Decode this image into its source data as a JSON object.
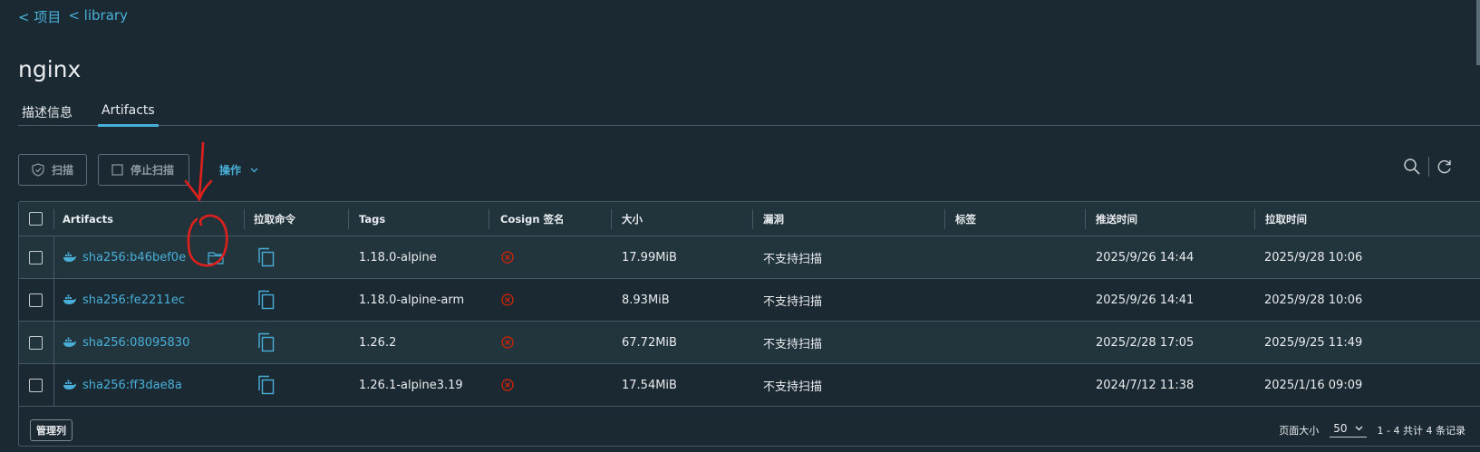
{
  "breadcrumb": [
    {
      "label": "< 项目"
    },
    {
      "label": "< library"
    }
  ],
  "page_title": "nginx",
  "tabs": [
    {
      "label": "描述信息",
      "active": false
    },
    {
      "label": "Artifacts",
      "active": true
    }
  ],
  "toolbar": {
    "scan_label": "扫描",
    "stop_scan_label": "停止扫描",
    "actions_label": "操作"
  },
  "table": {
    "headers": [
      "Artifacts",
      "拉取命令",
      "Tags",
      "Cosign 签名",
      "大小",
      "漏洞",
      "标签",
      "推送时间",
      "拉取时间"
    ],
    "rows": [
      {
        "digest": "sha256:b46bef0e",
        "tag": "1.18.0-alpine",
        "size": "17.99MiB",
        "vuln": "不支持扫描",
        "labels": "",
        "pushed": "2025/9/26 14:44",
        "pulled": "2025/9/28 10:06"
      },
      {
        "digest": "sha256:fe2211ec",
        "tag": "1.18.0-alpine-arm",
        "size": "8.93MiB",
        "vuln": "不支持扫描",
        "labels": "",
        "pushed": "2025/9/26 14:41",
        "pulled": "2025/9/28 10:06"
      },
      {
        "digest": "sha256:08095830",
        "tag": "1.26.2",
        "size": "67.72MiB",
        "vuln": "不支持扫描",
        "labels": "",
        "pushed": "2025/2/28 17:05",
        "pulled": "2025/9/25 11:49"
      },
      {
        "digest": "sha256:ff3dae8a",
        "tag": "1.26.1-alpine3.19",
        "size": "17.54MiB",
        "vuln": "不支持扫描",
        "labels": "",
        "pushed": "2024/7/12 11:38",
        "pulled": "2025/1/16 09:09"
      }
    ]
  },
  "footer": {
    "manage_columns_label": "管理列",
    "page_size_label": "页面大小",
    "page_size_value": "50",
    "summary": "1 - 4 共计 4 条记录"
  },
  "colors": {
    "background": "#1b2a32",
    "accent": "#49afd9",
    "border": "#495865",
    "error": "#e12200",
    "annotation": "#e0201c"
  },
  "icons": [
    "shield-icon",
    "checkbox-icon",
    "chevron-down-icon",
    "search-icon",
    "refresh-icon",
    "docker-icon",
    "folder-icon",
    "copy-icon",
    "error-circle-icon"
  ]
}
